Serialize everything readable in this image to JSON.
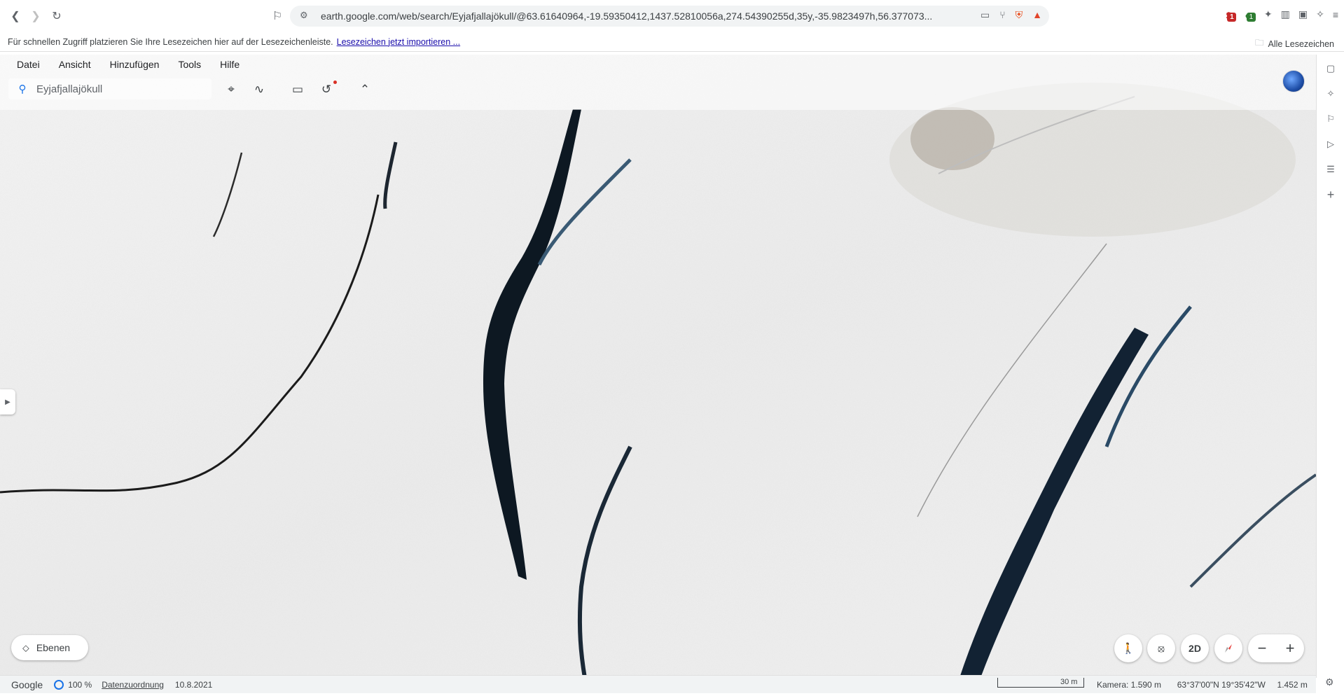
{
  "browser": {
    "url": "earth.google.com/web/search/Eyjafjallajökull/@63.61640964,-19.59350412,1437.52810056a,274.54390255d,35y,-35.9823497h,56.377073...",
    "bookmarks_text": "Für schnellen Zugriff platzieren Sie Ihre Lesezeichen hier auf der Lesezeichenleiste.",
    "bookmarks_link": "Lesezeichen jetzt importieren ...",
    "all_bookmarks": "Alle Lesezeichen",
    "ext_badge_1": "1",
    "ext_badge_2": "1"
  },
  "menu": {
    "items": [
      "Datei",
      "Ansicht",
      "Hinzufügen",
      "Tools",
      "Hilfe"
    ]
  },
  "search": {
    "value": "Eyjafjallajökull"
  },
  "layers_button": "Ebenen",
  "view_mode": "2D",
  "status": {
    "brand": "Google",
    "percent": "100 %",
    "attribution": "Datenzuordnung",
    "date": "10.8.2021",
    "scale": "30 m",
    "camera": "Kamera: 1.590 m",
    "coordinates": "63°37'00\"N 19°35'42\"W",
    "elevation": "1.452 m"
  },
  "colors": {
    "accent": "#1a73e8",
    "ice": "#f2f2f2",
    "crevasse": "#0b1520"
  }
}
